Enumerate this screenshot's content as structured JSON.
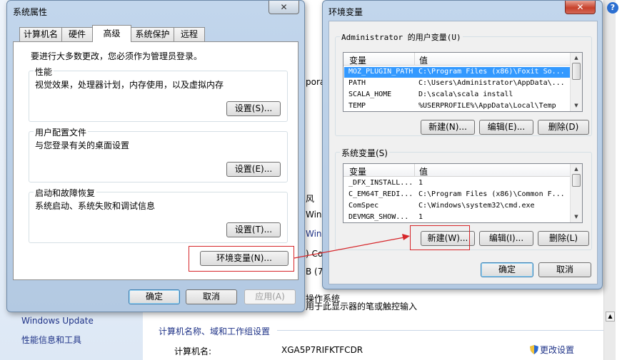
{
  "background": {
    "sidebar_links": [
      "Windows Update",
      "性能信息和工具"
    ],
    "section_title": "计算机名称、域和工作组设置",
    "computer_name_label": "计算机名:",
    "computer_name_value": "XGA5P7RIFKTFCDR",
    "change_settings": "更改设置",
    "fragments": [
      "pora",
      "风",
      "Win",
      "Win",
      ") Co",
      "B (7",
      "操作系统",
      "用于此显示器的笔或触控输入"
    ]
  },
  "sysprops": {
    "title": "系统属性",
    "close": "✕",
    "tabs": [
      "计算机名",
      "硬件",
      "高级",
      "系统保护",
      "远程"
    ],
    "active_tab": "高级",
    "admin_note": "要进行大多数更改，您必须作为管理员登录。",
    "groups": [
      {
        "legend": "性能",
        "desc": "视觉效果，处理器计划，内存使用，以及虚拟内存",
        "button": "设置(S)..."
      },
      {
        "legend": "用户配置文件",
        "desc": "与您登录有关的桌面设置",
        "button": "设置(E)..."
      },
      {
        "legend": "启动和故障恢复",
        "desc": "系统启动、系统失败和调试信息",
        "button": "设置(T)..."
      }
    ],
    "env_button": "环境变量(N)...",
    "ok": "确定",
    "cancel": "取消",
    "apply": "应用(A)"
  },
  "envvars": {
    "title": "环境变量",
    "close": "✕",
    "user_group": "Administrator 的用户变量(U)",
    "col_var": "变量",
    "col_val": "值",
    "user_vars": [
      {
        "name": "MOZ_PLUGIN_PATH",
        "value": "C:\\Program Files (x86)\\Foxit So...",
        "selected": true
      },
      {
        "name": "PATH",
        "value": "C:\\Users\\Administrator\\AppData\\...",
        "selected": false
      },
      {
        "name": "SCALA_HOME",
        "value": "D:\\scala\\scala install",
        "selected": false
      },
      {
        "name": "TEMP",
        "value": "%USERPROFILE%\\AppData\\Local\\Temp",
        "selected": false
      }
    ],
    "user_buttons": {
      "new": "新建(N)...",
      "edit": "编辑(E)...",
      "delete": "删除(D)"
    },
    "sys_group": "系统变量(S)",
    "sys_vars": [
      {
        "name": "_DFX_INSTALL...",
        "value": "1"
      },
      {
        "name": "C_EM64T_REDI...",
        "value": "C:\\Program Files (x86)\\Common F..."
      },
      {
        "name": "ComSpec",
        "value": "C:\\Windows\\system32\\cmd.exe"
      },
      {
        "name": "DEVMGR_SHOW...",
        "value": "1"
      }
    ],
    "sys_buttons": {
      "new": "新建(W)...",
      "edit": "编辑(I)...",
      "delete": "删除(L)"
    },
    "ok": "确定",
    "cancel": "取消"
  },
  "colors": {
    "annotation": "#d6262a",
    "selection": "#3399ff",
    "link": "#1e3287"
  }
}
